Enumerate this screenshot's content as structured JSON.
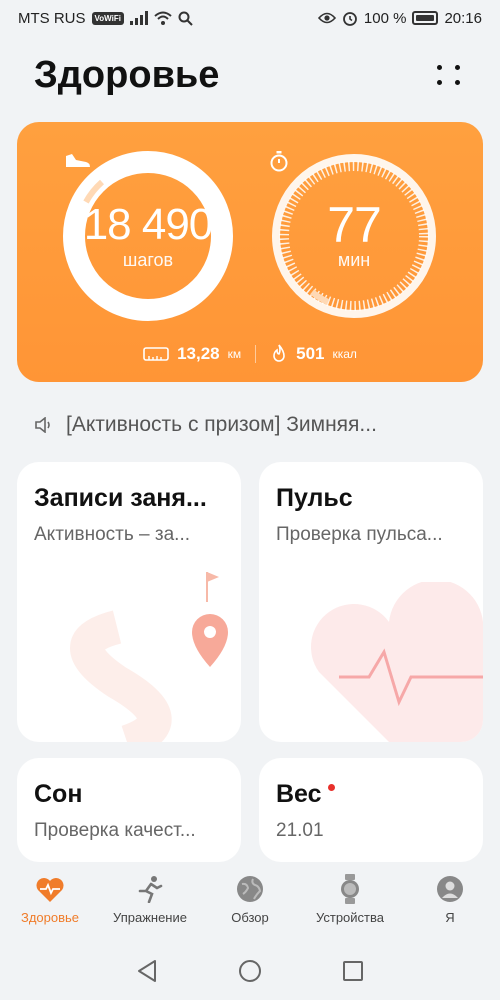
{
  "status_bar": {
    "carrier": "MTS RUS",
    "volte": "VoWiFi",
    "battery": "100 %",
    "time": "20:16"
  },
  "header": {
    "title": "Здоровье"
  },
  "activity": {
    "steps_value": "18 490",
    "steps_unit": "шагов",
    "minutes_value": "77",
    "minutes_unit": "мин",
    "distance_value": "13,28",
    "distance_unit": "км",
    "calories_value": "501",
    "calories_unit": "ккал",
    "accent": "#ff9a3a"
  },
  "announcement": {
    "text": "[Активность с призом] Зимняя..."
  },
  "tiles": {
    "workouts": {
      "title": "Записи заня...",
      "subtitle": "Активность – за..."
    },
    "pulse": {
      "title": "Пульс",
      "subtitle": "Проверка пульса..."
    },
    "sleep": {
      "title": "Сон",
      "subtitle": "Проверка качест..."
    },
    "weight": {
      "title": "Вес",
      "subtitle": "21.01"
    }
  },
  "bottom_nav": {
    "items": [
      {
        "label": "Здоровье",
        "icon": "heart-pulse-icon",
        "active": true
      },
      {
        "label": "Упражнение",
        "icon": "running-icon",
        "active": false
      },
      {
        "label": "Обзор",
        "icon": "globe-icon",
        "active": false
      },
      {
        "label": "Устройства",
        "icon": "watch-icon",
        "active": false
      },
      {
        "label": "Я",
        "icon": "profile-icon",
        "active": false
      }
    ]
  }
}
